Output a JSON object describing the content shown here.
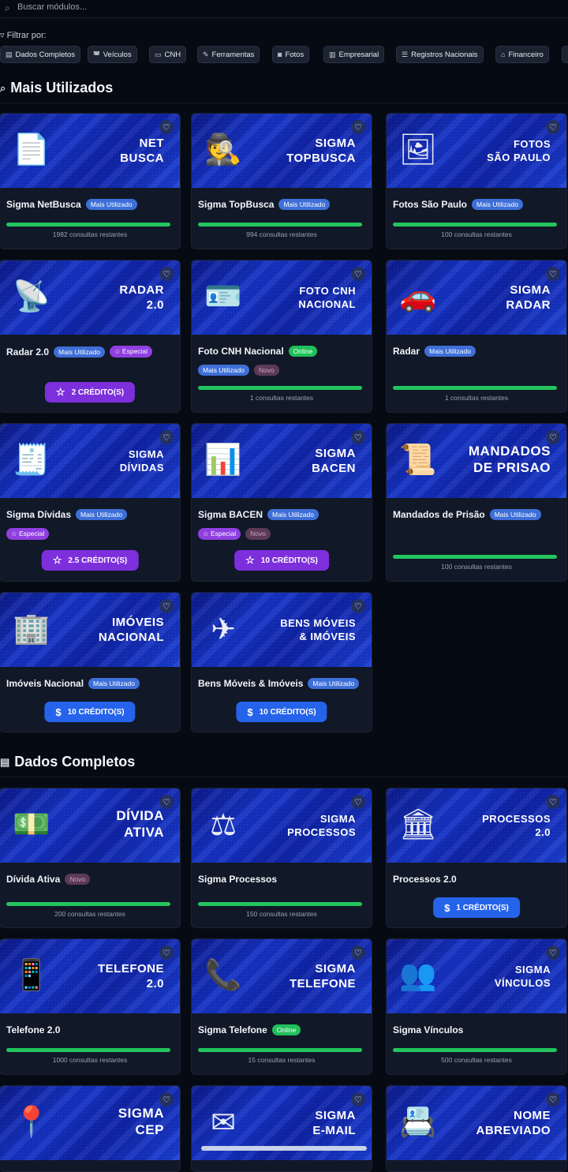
{
  "search": {
    "placeholder": "Buscar módulos..."
  },
  "filter": {
    "label": "Filtrar por:",
    "chips": [
      "Dados Completos",
      "Veículos",
      "CNH",
      "Ferramentas",
      "Fotos",
      "Empresarial",
      "Registros Nacionais",
      "Financeiro"
    ]
  },
  "sections": [
    {
      "title": "Mais Utilizados"
    },
    {
      "title": "Dados Completos"
    }
  ],
  "badges": {
    "mais_utilizado": "Mais Utilizado",
    "online": "Online",
    "especial": "Especial",
    "novo": "Novo"
  },
  "cards": [
    {
      "banner": "NET\nBUSCA",
      "name": "Sigma NetBusca",
      "badge": "Mais Utilizado",
      "progress": 1,
      "footer": "1982 consultas restantes"
    },
    {
      "banner": "SIGMA\nTOPBUSCA",
      "name": "Sigma TopBusca",
      "badge": "Mais Utilizado",
      "progress": 1,
      "footer": "994 consultas restantes"
    },
    {
      "banner": "FOTOS\nSÃO PAULO",
      "name": "Fotos São Paulo",
      "badge": "Mais Utilizado",
      "progress": 1,
      "footer": "100 consultas restantes"
    },
    {
      "banner": "RADAR\n2.0",
      "name": "Radar 2.0",
      "badge": "Mais Utilizado",
      "badge2": "Especial",
      "button": "2 CRÉDITO(S)"
    },
    {
      "banner": "FOTO CNH\nNACIONAL",
      "name": "Foto CNH Nacional",
      "badge": "Online",
      "row": [
        "Mais Utilizado",
        "Novo"
      ],
      "progress": 1,
      "footer": "1 consultas restantes"
    },
    {
      "banner": "SIGMA\nRADAR",
      "name": "Radar",
      "badge": "Mais Utilizado",
      "progress": 1,
      "footer": "1 consultas restantes"
    },
    {
      "banner": "SIGMA\nDÍVIDAS",
      "name": "Sigma Dívidas",
      "badge": "Mais Utilizado",
      "row": [
        "Especial"
      ],
      "button": "2.5 CRÉDITO(S)"
    },
    {
      "banner": "SIGMA\nBACEN",
      "name": "Sigma BACEN",
      "badge": "Mais Utilizado",
      "row": [
        "Especial",
        "Novo"
      ],
      "button": "10 CRÉDITO(S)"
    },
    {
      "banner": "MANDADOS\nDE PRISAO",
      "name": "Mandados de Prisão",
      "badge": "Mais Utilizado",
      "progress": 1,
      "footer": "100 consultas restantes"
    },
    {
      "banner": "IMÓVEIS\nNACIONAL",
      "name": "Imóveis Nacional",
      "badge": "Mais Utilizado",
      "button": "10 CRÉDITO(S)"
    },
    {
      "banner": "BENS MÓVEIS\n& IMÓVEIS",
      "name": "Bens Móveis & Imóveis",
      "badge": "Mais Utilizado",
      "button": "10 CRÉDITO(S)"
    },
    {
      "banner": "DÍVIDA\nATIVA",
      "name": "Dívida Ativa",
      "badge": "Novo",
      "progress": 1,
      "footer": "200 consultas restantes"
    },
    {
      "banner": "SIGMA\nPROCESSOS",
      "name": "Sigma Processos",
      "progress": 1,
      "footer": "150 consultas restantes"
    },
    {
      "banner": "PROCESSOS\n2.0",
      "name": "Processos 2.0",
      "button": "1 CRÉDITO(S)"
    },
    {
      "banner": "TELEFONE\n2.0",
      "name": "Telefone 2.0",
      "progress": 1,
      "footer": "1000 consultas restantes"
    },
    {
      "banner": "SIGMA\nTELEFONE",
      "name": "Sigma Telefone",
      "badge": "Online",
      "progress": 1,
      "footer": "15 consultas restantes"
    },
    {
      "banner": "SIGMA\nVÍNCULOS",
      "name": "Sigma Vínculos",
      "progress": 1,
      "footer": "500 consultas restantes"
    },
    {
      "banner": "SIGMA\nCEP"
    },
    {
      "banner": "SIGMA\nE-MAIL"
    },
    {
      "banner": "NOME\nABREVIADO"
    }
  ],
  "colors": {
    "accent_green": "#23c45e",
    "badge_blue": "#3e6fd8",
    "purple_button": "#7d2fdc",
    "blue_button": "#2563eb"
  }
}
